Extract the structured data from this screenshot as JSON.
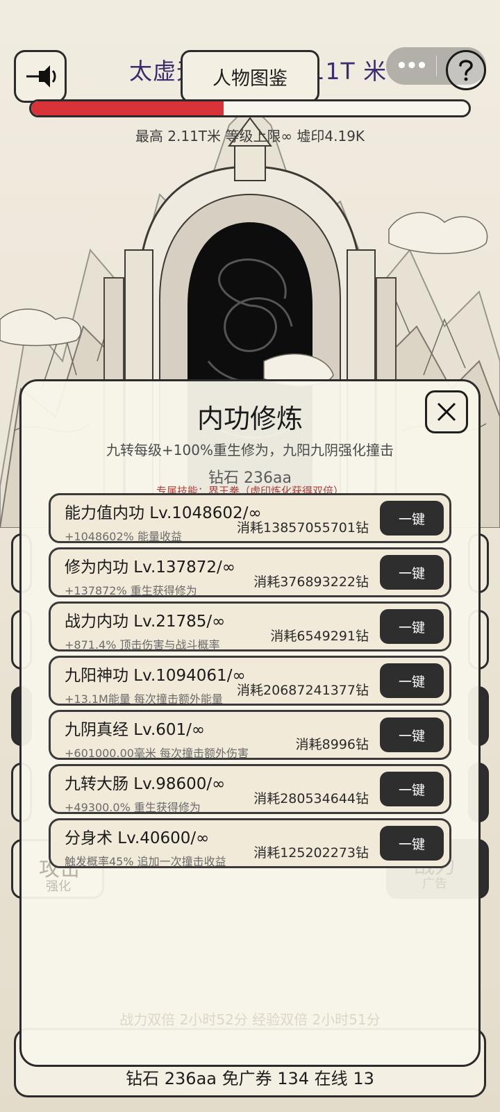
{
  "header": {
    "stage_title": "太虚无尽 当前 2.11T 米",
    "codex_label": "人物图鉴",
    "more_icon": "more-dots-icon",
    "progress": 0.44,
    "stats_line": "最高 2.11T米 等级上限∞ 墟印4.19K"
  },
  "modal": {
    "title": "内功修炼",
    "description": "九转每级+100%重生修为，九阳九阴强化撞击",
    "diamond": "钻石 236aa",
    "exclusive_skill": "专属技能：界王拳（虚印炼化获得双倍）",
    "button_label": "一键",
    "rows": [
      {
        "name": "能力值内功 Lv.1048602/∞",
        "effect": "+1048602%  能量收益",
        "cost": "消耗13857055701钻"
      },
      {
        "name": "修为内功 Lv.137872/∞",
        "effect": "+137872%  重生获得修为",
        "cost": "消耗376893222钻"
      },
      {
        "name": "战力内功 Lv.21785/∞",
        "effect": "+871.4%  顶击伤害与战斗概率",
        "cost": "消耗6549291钻"
      },
      {
        "name": "九阳神功 Lv.1094061/∞",
        "effect": "+13.1M能量  每次撞击额外能量",
        "cost": "消耗20687241377钻"
      },
      {
        "name": "九阴真经 Lv.601/∞",
        "effect": "+601000.00毫米  每次撞击额外伤害",
        "cost": "消耗8996钻"
      },
      {
        "name": "九转大肠 Lv.98600/∞",
        "effect": "+49300.0%  重生获得修为",
        "cost": "消耗280534644钻"
      },
      {
        "name": "分身术 Lv.40600/∞",
        "effect": "触发概率45%  追加一次撞击收益",
        "cost": "消耗125202273钻"
      }
    ]
  },
  "background": {
    "attack_label": "攻击",
    "attack_sub": "强化",
    "power_label": "战力",
    "power_sub": "广告",
    "faded_line": "战力双倍 2小时52分  经验双倍 2小时51分"
  },
  "footer": {
    "text": "钻石 236aa   免广券 134   在线 13"
  },
  "colors": {
    "accent_red": "#d9333a",
    "title_purple": "#3b2d6e",
    "button_dark": "#2e2e2e"
  }
}
